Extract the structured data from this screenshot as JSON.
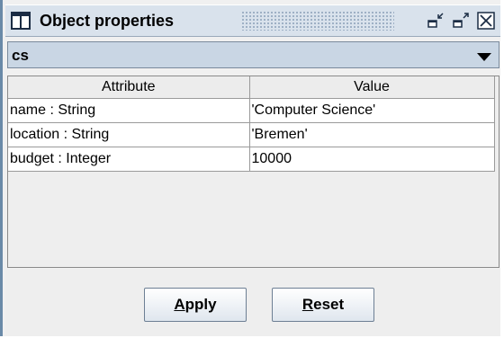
{
  "window": {
    "title": "Object properties",
    "icon": "window-icon",
    "controls": [
      "minimize-icon",
      "maximize-icon",
      "close-icon"
    ]
  },
  "object_select": {
    "selected": "cs"
  },
  "table": {
    "headers": [
      "Attribute",
      "Value"
    ],
    "rows": [
      {
        "attribute": "name : String",
        "value": "'Computer Science'"
      },
      {
        "attribute": "location : String",
        "value": "'Bremen'"
      },
      {
        "attribute": "budget : Integer",
        "value": "10000"
      }
    ]
  },
  "buttons": {
    "apply": {
      "mnemonic": "A",
      "rest": "pply"
    },
    "reset": {
      "mnemonic": "R",
      "rest": "eset"
    }
  },
  "colors": {
    "title_bar": "#d9e2ec",
    "combo_bg": "#c9d6e4",
    "frame_border": "#6a8aa8"
  }
}
